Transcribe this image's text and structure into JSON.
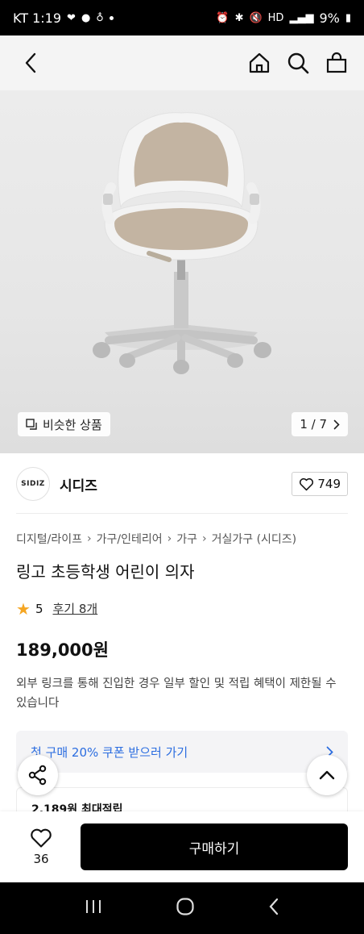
{
  "status_bar": {
    "carrier_time": "KT 1:19",
    "battery": "9%"
  },
  "gallery": {
    "similar_label": "비슷한 상품",
    "page_counter": "1 / 7"
  },
  "seller": {
    "logo_text": "SIDIZ",
    "name": "시디즈",
    "like_count": "749"
  },
  "breadcrumb": [
    "디지털/라이프",
    "가구/인테리어",
    "가구",
    "거실가구 (시디즈)"
  ],
  "product": {
    "title": "링고 초등학생 어린이 의자",
    "rating": "5",
    "review_label": "후기 8개",
    "price": "189,000원",
    "notice": "외부 링크를 통해 진입한 경우 일부 할인 및 적립 혜택이 제한될 수 있습니다"
  },
  "coupon": {
    "label": "첫 구매 20% 쿠폰 받으러 가기"
  },
  "points": {
    "label": "2,189원 최대적립"
  },
  "purchase_bar": {
    "wish_count": "36",
    "buy_label": "구매하기"
  },
  "colors": {
    "accent_link": "#2b6de0",
    "star": "#f5a623",
    "buy_button": "#000000"
  }
}
